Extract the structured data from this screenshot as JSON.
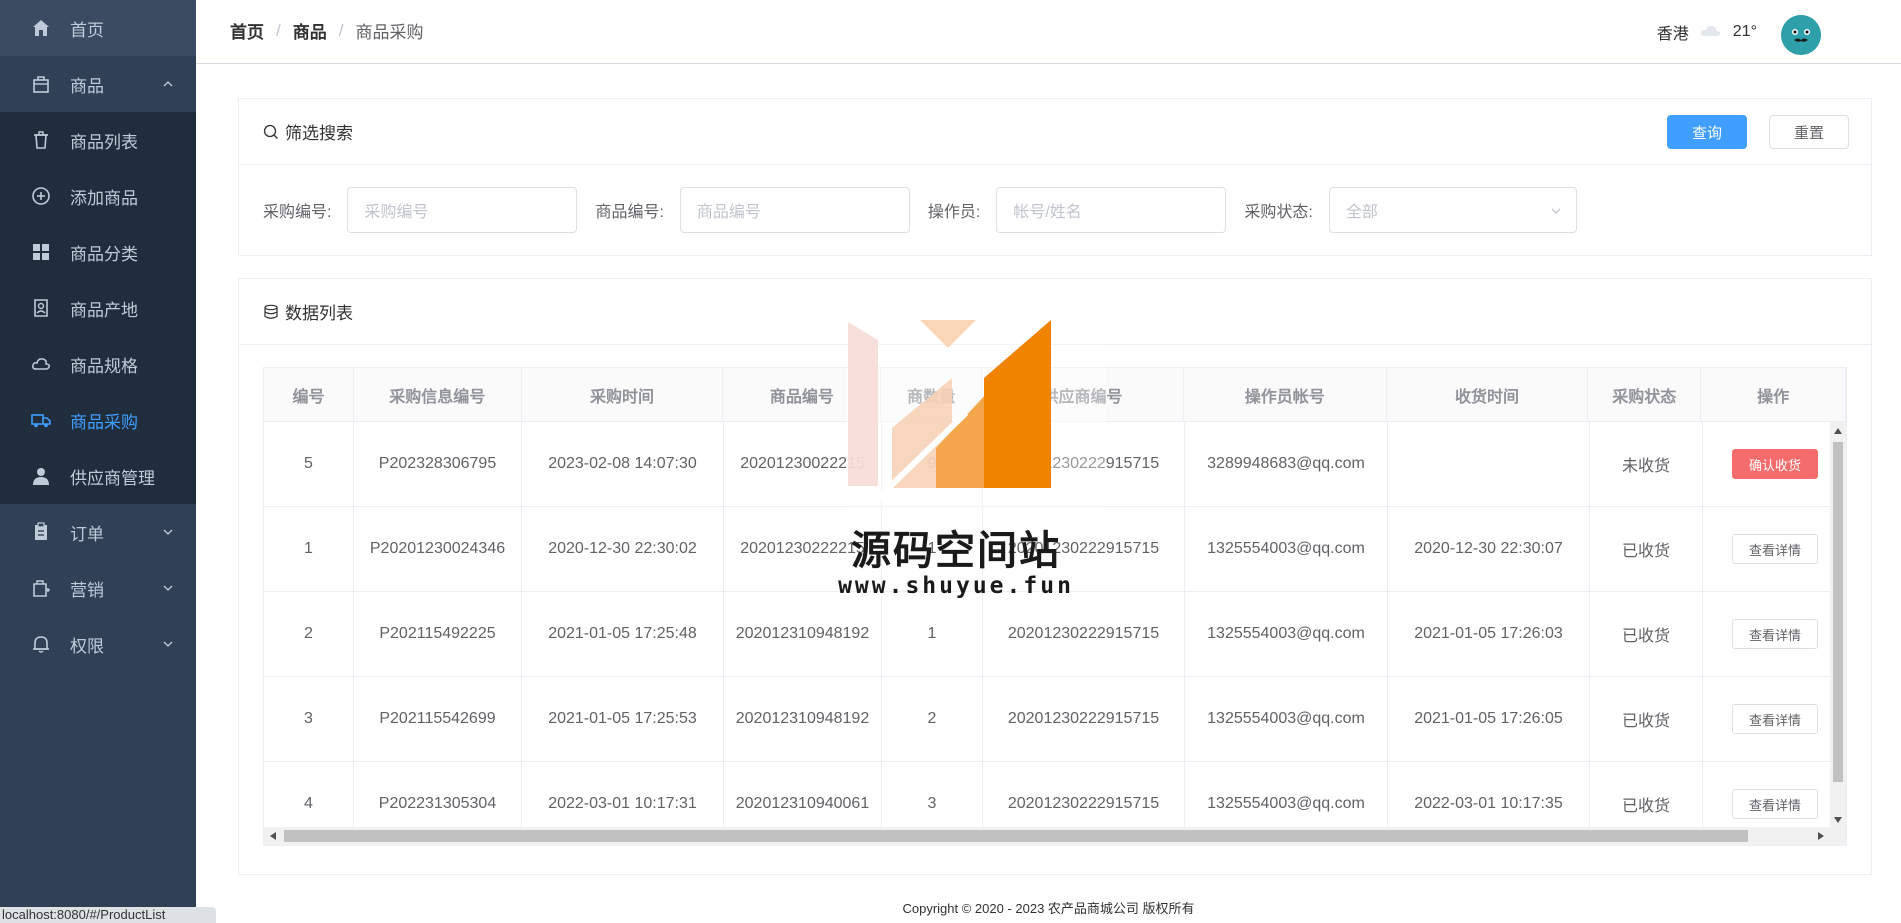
{
  "sidebar": {
    "home": "首页",
    "goods": "商品",
    "goods_items": [
      "商品列表",
      "添加商品",
      "商品分类",
      "商品产地",
      "商品规格",
      "商品采购",
      "供应商管理"
    ],
    "order": "订单",
    "marketing": "营销",
    "permission": "权限"
  },
  "breadcrumb": [
    "首页",
    "商品",
    "商品采购"
  ],
  "weather": {
    "city": "香港",
    "temp": "21°"
  },
  "filter": {
    "title": "筛选搜索",
    "query_btn": "查询",
    "reset_btn": "重置",
    "labels": [
      "采购编号:",
      "商品编号:",
      "操作员:",
      "采购状态:"
    ],
    "placeholders": [
      "采购编号",
      "商品编号",
      "帐号/姓名",
      "全部"
    ]
  },
  "list": {
    "title": "数据列表",
    "columns": [
      "编号",
      "采购信息编号",
      "采购时间",
      "商品编号",
      "商数量",
      "供应商编号",
      "操作员帐号",
      "收货时间",
      "采购状态",
      "操作"
    ],
    "rows": [
      [
        "5",
        "P202328306795",
        "2023-02-08 14:07:30",
        "20201230022215",
        "9",
        "20201230222915715",
        "3289948683@qq.com",
        "",
        "未收货",
        "确认收货"
      ],
      [
        "1",
        "P20201230024346",
        "2020-12-30 22:30:02",
        "20201230222215",
        "1",
        "20201230222915715",
        "1325554003@qq.com",
        "2020-12-30 22:30:07",
        "已收货",
        "查看详情"
      ],
      [
        "2",
        "P202115492225",
        "2021-01-05 17:25:48",
        "202012310948192",
        "1",
        "20201230222915715",
        "1325554003@qq.com",
        "2021-01-05 17:26:03",
        "已收货",
        "查看详情"
      ],
      [
        "3",
        "P202115542699",
        "2021-01-05 17:25:53",
        "202012310948192",
        "2",
        "20201230222915715",
        "1325554003@qq.com",
        "2021-01-05 17:26:05",
        "已收货",
        "查看详情"
      ],
      [
        "4",
        "P202231305304",
        "2022-03-01 10:17:31",
        "202012310940061",
        "3",
        "20201230222915715",
        "1325554003@qq.com",
        "2022-03-01 10:17:35",
        "已收货",
        "查看详情"
      ]
    ]
  },
  "footer": "Copyright © 2020 - 2023  农产品商城公司 版权所有",
  "statusbar": "localhost:8080/#/ProductList",
  "watermark": {
    "title": "源码空间站",
    "url": "www.shuyue.fun"
  },
  "colors": {
    "sidebar": "#304156",
    "active": "#409eff",
    "danger": "#f56c6c",
    "wm_orange": "#f08300"
  }
}
